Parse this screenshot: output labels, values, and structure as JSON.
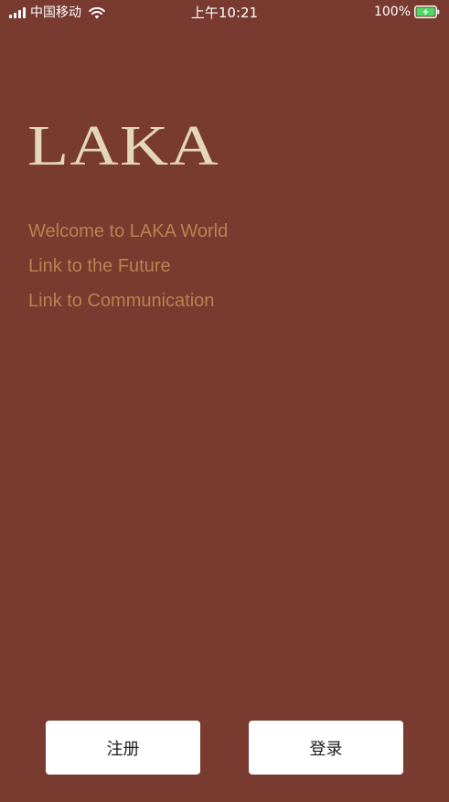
{
  "status_bar": {
    "carrier": "中国移动",
    "time": "上午10:21",
    "battery": "100%",
    "battery_level": 1.0,
    "battery_color": "#4cd964",
    "icons": [
      "signal-icon",
      "wifi-icon",
      "battery-charging-icon"
    ]
  },
  "logo": {
    "text": "LAKA",
    "color": "#e4d6bd"
  },
  "welcome": {
    "lines": [
      "Welcome to LAKA World",
      "Link to the Future",
      "Link to Communication"
    ],
    "color": "#b7844e"
  },
  "buttons": {
    "register": "注册",
    "login": "登录"
  },
  "colors": {
    "background": "#793a30",
    "button_background": "#ffffff",
    "button_text": "#1b1b1b"
  }
}
